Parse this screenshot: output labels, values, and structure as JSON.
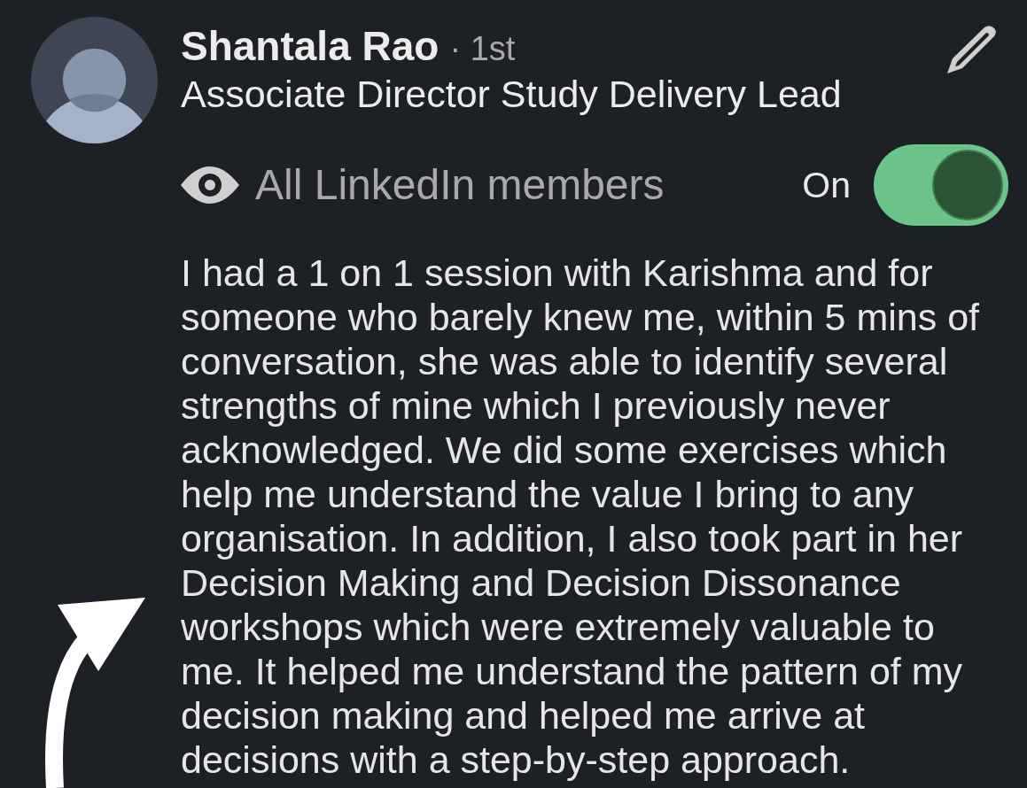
{
  "profile": {
    "name": "Shantala Rao",
    "connection_degree": "· 1st",
    "headline": "Associate Director Study Delivery Lead"
  },
  "visibility": {
    "label": "All LinkedIn members",
    "status": "On",
    "on": true
  },
  "recommendation": {
    "text": "I had a 1 on 1 session with Karishma and for someone who barely knew me, within 5 mins of conversation, she was able to identify several strengths of mine which I previously never acknowledged. We did some exercises which help me understand the value I bring to any organisation. In addition, I also took part in her Decision Making and Decision Dissonance workshops which were extremely valuable to me. It helped me understand the pattern of my decision making and helped me arrive at decisions with a step-by-step approach."
  }
}
